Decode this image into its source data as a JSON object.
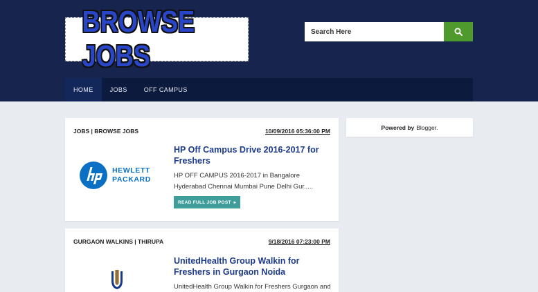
{
  "header": {
    "logo_text": "BROWSE JOBS",
    "search": {
      "placeholder": "Search Here",
      "button_icon": "search-icon"
    },
    "colors": {
      "background": "#17254e",
      "search_button": "#4f9a2c"
    }
  },
  "nav": {
    "items": [
      {
        "label": "HOME",
        "active": true
      },
      {
        "label": "JOBS",
        "active": false
      },
      {
        "label": "OFF CAMPUS",
        "active": false
      }
    ]
  },
  "posts": [
    {
      "category": "JOBS | BROWSE JOBS",
      "date": "10/09/2016 05:36:00 PM",
      "title": "HP Off Campus Drive 2016-2017 for Freshers",
      "snippet": "HP OFF CAMPUS 2016-2017 in Bangalore Hyderabad Chennai Mumbai Pune Delhi Gur.....",
      "read_more": "READ FULL JOB POST",
      "thumbnail": {
        "icon": "hp-logo",
        "text_line1": "HEWLETT",
        "text_line2": "PACKARD"
      }
    },
    {
      "category": "GURGAON WALKINS | THIRUPA",
      "date": "9/18/2016 07:23:00 PM",
      "title": "UnitedHealth Group Walkin for Freshers in Gurgaon Noida",
      "snippet": "UnitedHealth Group Walkin for Freshers Gurgaon and",
      "thumbnail": {
        "icon": "unitedhealth-logo"
      }
    }
  ],
  "sidebar": {
    "powered_label": "Powered by",
    "powered_link": "Blogger."
  }
}
